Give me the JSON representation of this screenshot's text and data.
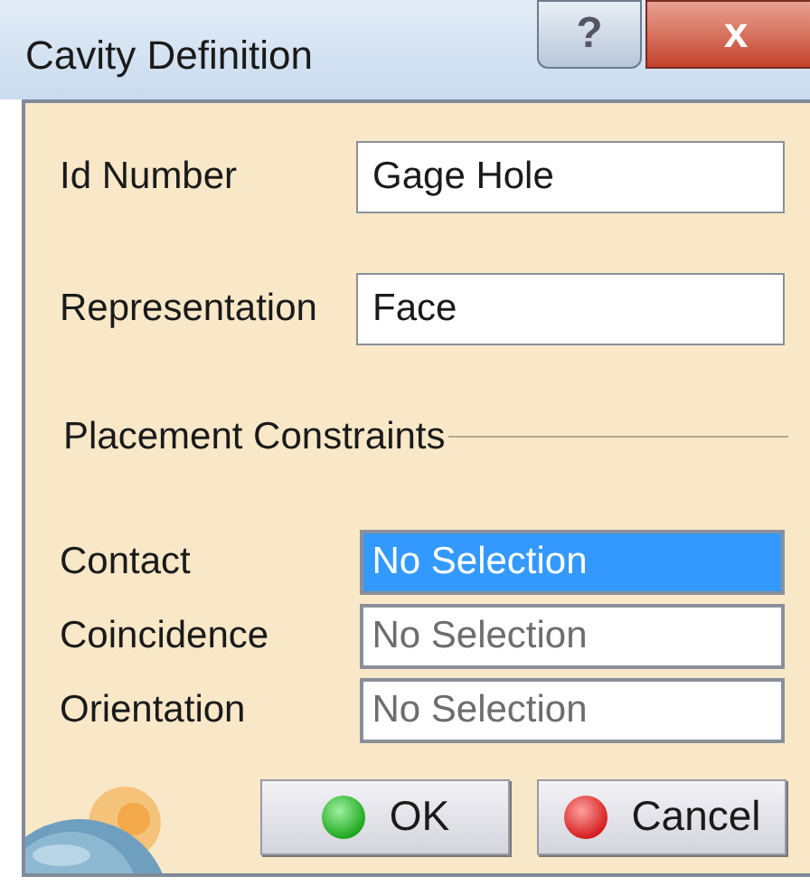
{
  "window": {
    "title": "Cavity Definition",
    "help_button": "?",
    "close_button": "x"
  },
  "fields": [
    {
      "label": "Id Number",
      "value": "Gage Hole"
    },
    {
      "label": "Representation",
      "value": "Face"
    }
  ],
  "section": {
    "title": "Placement Constraints"
  },
  "constraints": [
    {
      "label": "Contact",
      "value": "No Selection",
      "selected": true
    },
    {
      "label": "Coincidence",
      "value": "No Selection",
      "selected": false
    },
    {
      "label": "Orientation",
      "value": "No Selection",
      "selected": false
    }
  ],
  "buttons": [
    {
      "label": "OK",
      "kind": "ok"
    },
    {
      "label": "Cancel",
      "kind": "cancel"
    }
  ]
}
